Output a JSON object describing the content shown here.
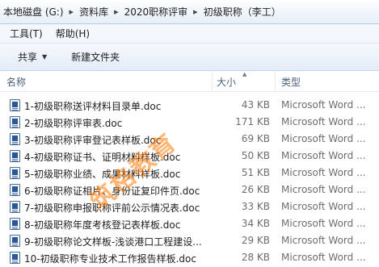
{
  "address": {
    "crumbs": [
      "本地磁盘 (G:)",
      "资料库",
      "2020职称评审",
      "初级职称（李工）"
    ]
  },
  "menu": {
    "tools": "工具(T)",
    "help": "帮助(H)"
  },
  "toolbar": {
    "share": "共享",
    "new_folder": "新建文件夹"
  },
  "columns": {
    "name": "名称",
    "size": "大小",
    "type": "类型"
  },
  "files": [
    {
      "name": "1-初级职称送评材料目录单.doc",
      "size": "43 KB",
      "type": "Microsoft Word ..."
    },
    {
      "name": "2-初级职称评审表.doc",
      "size": "171 KB",
      "type": "Microsoft Word ..."
    },
    {
      "name": "3-初级职称评审登记表样板.doc",
      "size": "69 KB",
      "type": "Microsoft Word ..."
    },
    {
      "name": "4-初级职称证书、证明材料样板.doc",
      "size": "50 KB",
      "type": "Microsoft Word ..."
    },
    {
      "name": "5-初级职称业绩、成果材料样板.doc",
      "size": "51 KB",
      "type": "Microsoft Word ..."
    },
    {
      "name": "6-初级职称证相片、身份证复印件页.doc",
      "size": "26 KB",
      "type": "Microsoft Word ..."
    },
    {
      "name": "7-初级职称申报职称评前公示情况表.doc",
      "size": "33 KB",
      "type": "Microsoft Word ..."
    },
    {
      "name": "8-初级职称年度考核登记表样板.doc",
      "size": "34 KB",
      "type": "Microsoft Word ..."
    },
    {
      "name": "9-初级职称论文样板-浅谈港口工程建设...",
      "size": "29 KB",
      "type": "Microsoft Word ..."
    },
    {
      "name": "10-初级职称专业技术工作报告样板.doc",
      "size": "28 KB",
      "type": "Microsoft Word ..."
    }
  ],
  "watermark": "筑格教育",
  "colors": {
    "watermark": "#ff7800",
    "secondary_text": "#6d6d6d",
    "header_text": "#4c607a"
  }
}
